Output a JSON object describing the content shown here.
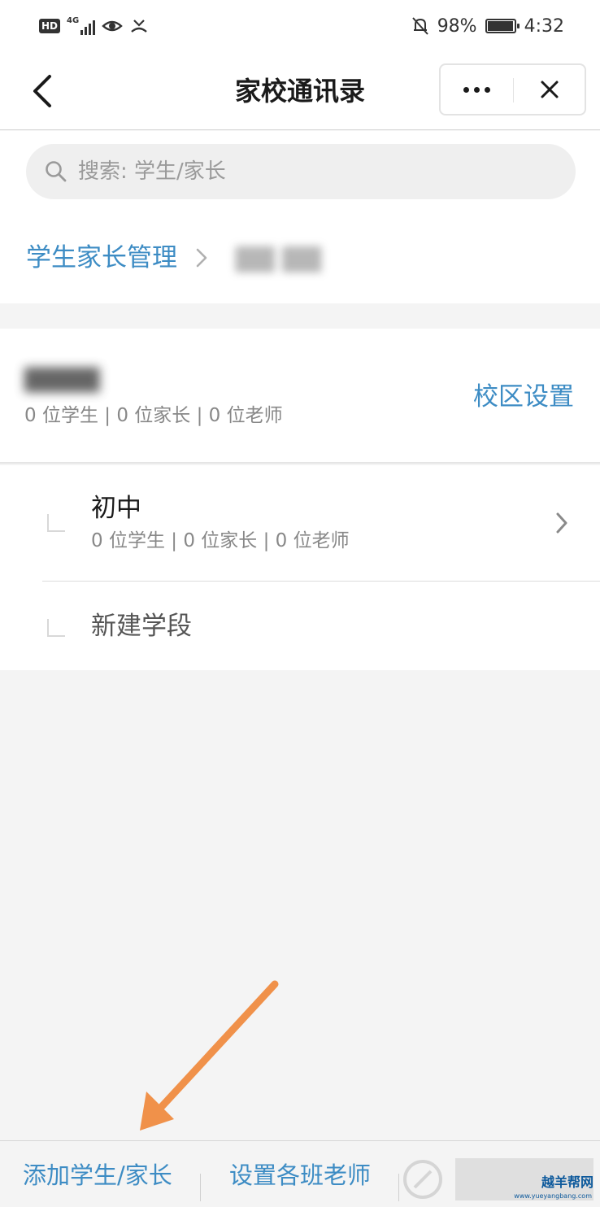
{
  "status_bar": {
    "hd": "HD",
    "network": "4G",
    "battery_percent": "98%",
    "battery_level": 0.98,
    "time": "4:32",
    "icons": [
      "hd-icon",
      "signal-icon",
      "eye-icon",
      "missed-call-icon",
      "mute-bell-icon",
      "battery-charging-icon"
    ]
  },
  "nav": {
    "title": "家校通讯录",
    "back_icon": "chevron-left-icon",
    "more_icon": "more-dots-icon",
    "close_icon": "close-icon"
  },
  "search": {
    "placeholder": "搜索: 学生/家长",
    "icon": "search-icon"
  },
  "breadcrumb": {
    "root": "学生家长管理",
    "current": "▇▇ ▇▇"
  },
  "school": {
    "name": "▇▇▇▇",
    "stats": "0 位学生 | 0 位家长 | 0 位老师",
    "campus_settings": "校区设置"
  },
  "stages": [
    {
      "name": "初中",
      "stats": "0 位学生 | 0 位家长 | 0 位老师"
    }
  ],
  "new_stage": "新建学段",
  "bottom_bar": {
    "add_student_parent": "添加学生/家长",
    "set_class_teachers": "设置各班老师"
  },
  "annotation": {
    "arrow_color": "#f0914a"
  },
  "watermark": {
    "text": "越羊帮网",
    "sub": "www.yueyangbang.com"
  },
  "colors": {
    "accent": "#3d8cc4",
    "background": "#f4f4f4"
  }
}
